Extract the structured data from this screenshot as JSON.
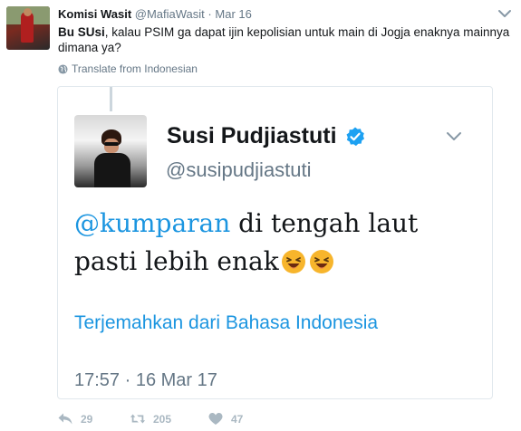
{
  "author": {
    "name": "Komisi Wasit",
    "handle": "@MafiaWasit",
    "separator": "·",
    "date": "Mar 16"
  },
  "tweet": {
    "bold_lead": "Bu SUsi",
    "text": ", kalau PSIM ga dapat ijin kepolisian untuk main di Jogja enaknya mainnya dimana ya?"
  },
  "translate_label": "Translate from Indonesian",
  "quoted": {
    "name": "Susi Pudjiastuti",
    "handle": "@susipudjiastuti",
    "mention": "@kumparan",
    "text_rest": " di tengah laut pasti lebih enak",
    "translate_label": "Terjemahkan dari Bahasa Indonesia",
    "timestamp": "17:57 · 16 Mar 17"
  },
  "actions": {
    "replies": "29",
    "retweets": "205",
    "likes": "47"
  },
  "colors": {
    "link": "#1b95e0",
    "muted": "#657786",
    "border": "#e1e8ed",
    "icon_muted": "#aab8c2",
    "verified": "#1da1f2"
  },
  "icons": [
    "caret-down-icon",
    "globe-icon",
    "verified-badge-icon",
    "laughing-emoji-icon",
    "reply-icon",
    "retweet-icon",
    "heart-icon"
  ]
}
